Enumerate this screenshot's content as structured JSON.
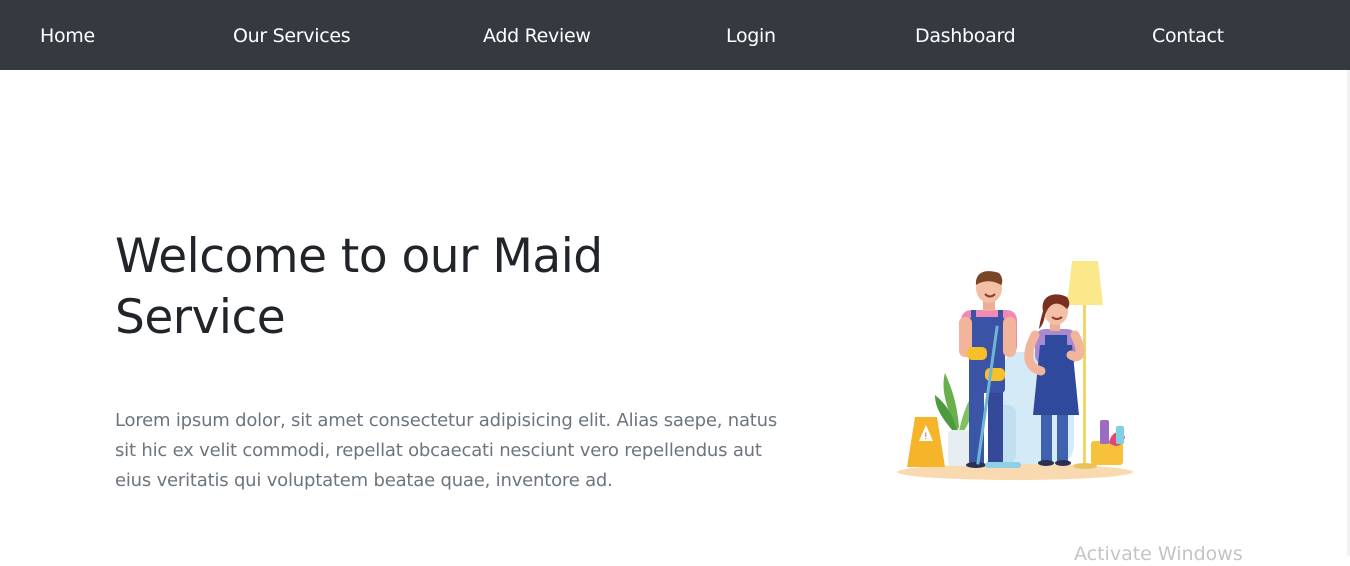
{
  "nav": {
    "items": [
      {
        "label": "Home"
      },
      {
        "label": "Our Services"
      },
      {
        "label": "Add Review"
      },
      {
        "label": "Login"
      },
      {
        "label": "Dashboard"
      },
      {
        "label": "Contact"
      }
    ]
  },
  "hero": {
    "title": "Welcome to our Maid Service",
    "description": "Lorem ipsum dolor, sit amet consectetur adipisicing elit. Alias saepe, natus sit hic ex velit commodi, repellat obcaecati nesciunt vero repellendus aut eius veritatis qui voluptatem beatae quae, inventore ad.",
    "illustration": "cleaning-staff-illustration"
  },
  "overlay": {
    "watermark": "Activate Windows"
  },
  "colors": {
    "navbar": "#343a40",
    "heading": "#212529",
    "body_text": "#6c757d"
  }
}
